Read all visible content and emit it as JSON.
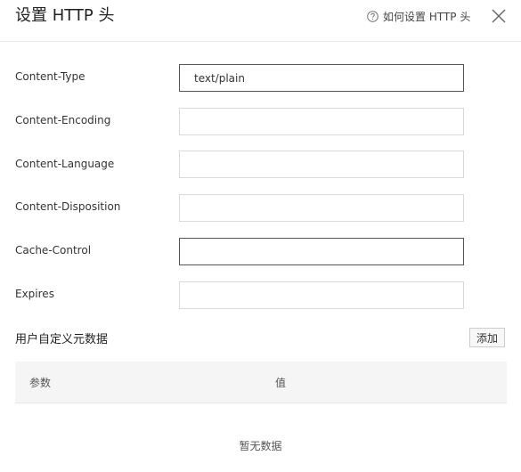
{
  "dialog": {
    "title": "设置 HTTP 头",
    "help_label": "如何设置 HTTP 头"
  },
  "fields": [
    {
      "label": "Content-Type",
      "value": "text/plain",
      "placeholder": ""
    },
    {
      "label": "Content-Encoding",
      "value": "",
      "placeholder": ""
    },
    {
      "label": "Content-Language",
      "value": "",
      "placeholder": ""
    },
    {
      "label": "Content-Disposition",
      "value": "",
      "placeholder": ""
    },
    {
      "label": "Cache-Control",
      "value": "",
      "placeholder": ""
    },
    {
      "label": "Expires",
      "value": "",
      "placeholder": ""
    }
  ],
  "metadata": {
    "section_title": "用户自定义元数据",
    "add_label": "添加",
    "columns": [
      "参数",
      "值"
    ],
    "empty_text": "暂无数据"
  },
  "colors": {
    "border": "#d9d9d9",
    "active_border": "#555555",
    "table_header_bg": "#f5f5f5"
  },
  "icons": {
    "help": "question-circle-icon",
    "close": "close-icon"
  }
}
